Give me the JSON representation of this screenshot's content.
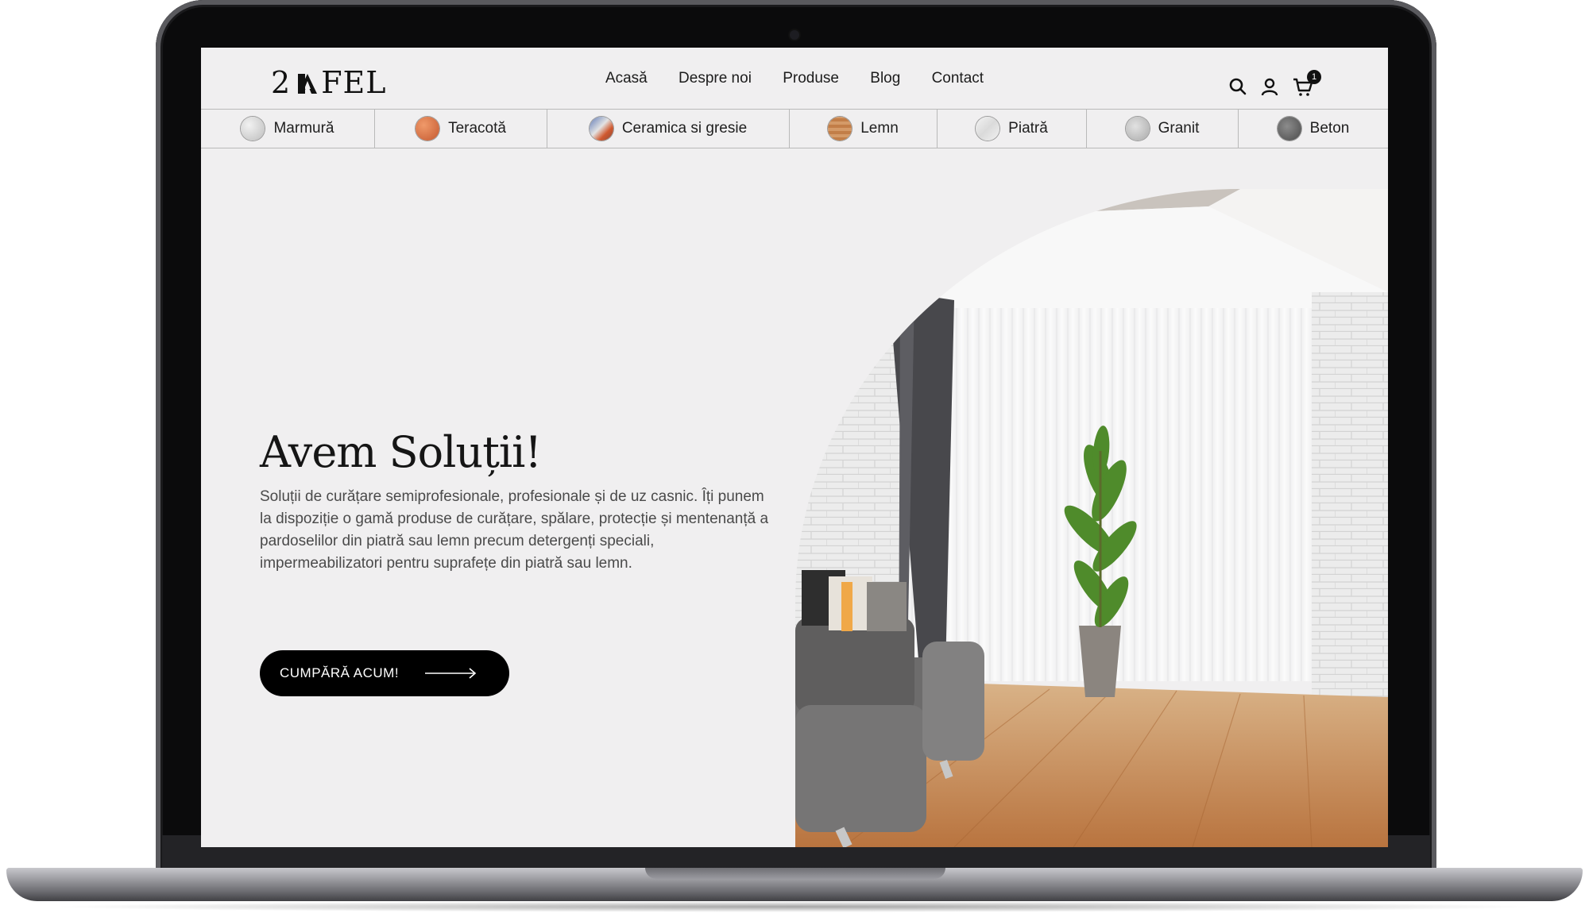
{
  "brand": {
    "logo_left": "2",
    "logo_right": "FEL"
  },
  "nav": {
    "items": [
      {
        "label": "Acasă"
      },
      {
        "label": "Despre noi"
      },
      {
        "label": "Produse"
      },
      {
        "label": "Blog"
      },
      {
        "label": "Contact"
      }
    ]
  },
  "header_icons": {
    "search": "search-icon",
    "account": "user-icon",
    "cart": "cart-icon",
    "cart_count": "1"
  },
  "categories": [
    {
      "label": "Marmură",
      "icon": "marble-swatch",
      "color": "#d6d6d6"
    },
    {
      "label": "Teracotă",
      "icon": "terracotta-swatch",
      "color": "#d9784a"
    },
    {
      "label": "Ceramica si gresie",
      "icon": "ceramic-swatch",
      "color": "#6f86b3"
    },
    {
      "label": "Lemn",
      "icon": "wood-swatch",
      "color": "#c98a57"
    },
    {
      "label": "Piatră",
      "icon": "stone-swatch",
      "color": "#e7e7e7"
    },
    {
      "label": "Granit",
      "icon": "granite-swatch",
      "color": "#c4c4c4"
    },
    {
      "label": "Beton",
      "icon": "concrete-swatch",
      "color": "#6f6f6f"
    }
  ],
  "hero": {
    "title": "Avem Soluții!",
    "text": "Soluții de curățare semiprofesionale, profesionale și de uz casnic. Îți punem la dispoziție o gamă produse de curățare, spălare, protecție și mentenanță a pardoselilor din piatră sau lemn precum detergenți speciali, impermeabilizatori pentru suprafețe din piatră sau lemn.",
    "cta_label": "CUMPĂRĂ ACUM!"
  },
  "colors": {
    "accent": "#000000",
    "page_bg": "#f0eff0",
    "text": "#151515"
  }
}
